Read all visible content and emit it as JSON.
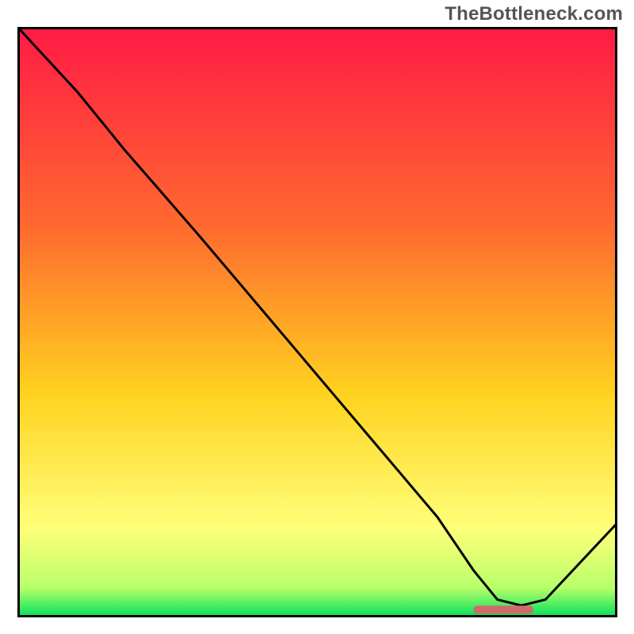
{
  "watermark": "TheBottleneck.com",
  "chart_data": {
    "type": "line",
    "title": "",
    "xlabel": "",
    "ylabel": "",
    "xlim": [
      0,
      100
    ],
    "ylim": [
      0,
      100
    ],
    "gradient_colors": {
      "top": "#ff1a45",
      "upper_mid": "#ff6a2f",
      "mid": "#ffd21f",
      "lower_mid": "#ffff7a",
      "light_green": "#b8ff6a",
      "bottom": "#00e05a"
    },
    "series": [
      {
        "name": "bottleneck-curve",
        "x": [
          0,
          10,
          18,
          30,
          40,
          50,
          60,
          70,
          76,
          80,
          84,
          88,
          100
        ],
        "y": [
          100,
          89,
          79,
          65,
          53,
          41,
          29,
          17,
          8,
          3,
          2,
          3,
          16
        ]
      }
    ],
    "marker": {
      "name": "optimal-range-marker",
      "x_start": 76,
      "x_end": 86,
      "y": 1.3,
      "color": "#d26a6a"
    }
  }
}
